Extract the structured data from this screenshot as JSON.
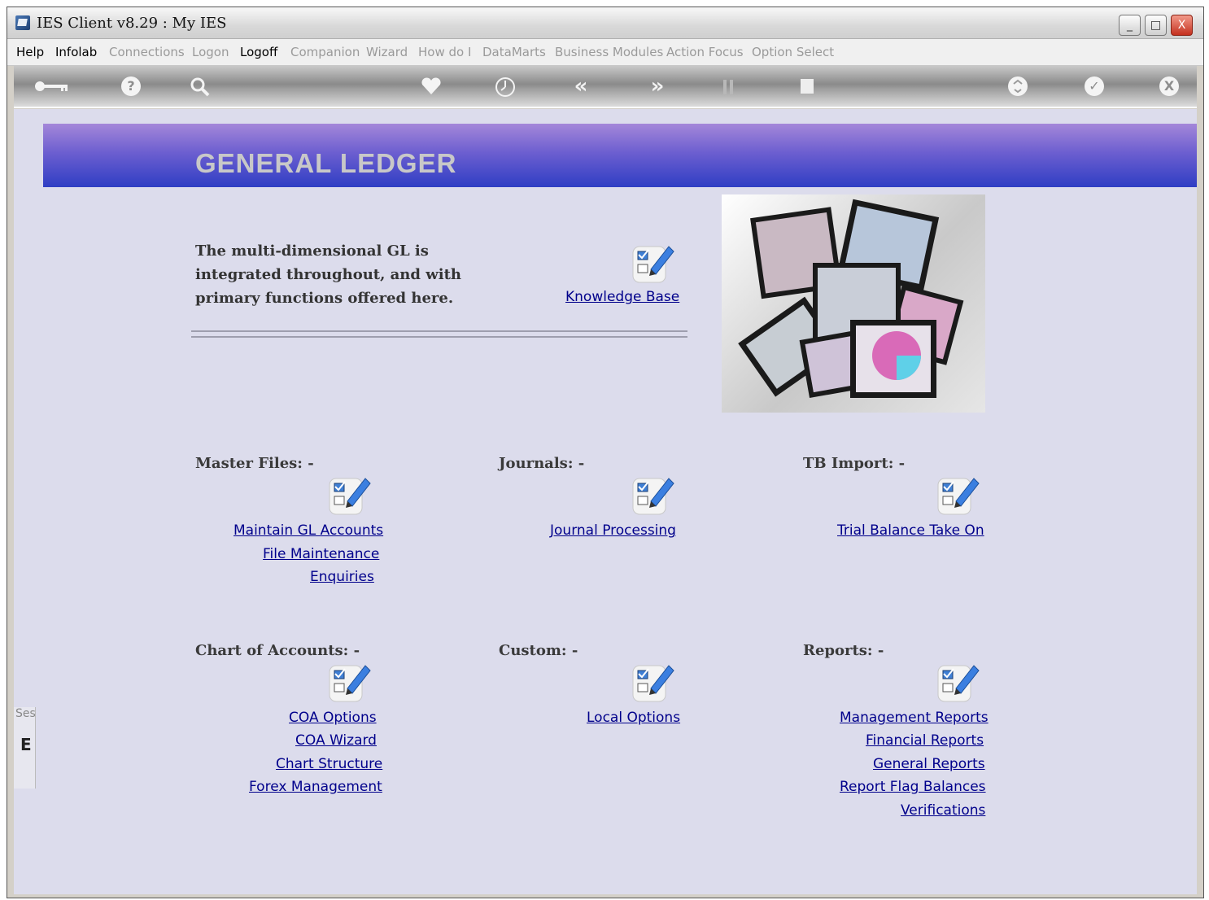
{
  "window": {
    "title": "IES Client v8.29 : My IES",
    "controls": {
      "minimize": "_",
      "maximize": "□",
      "close": "X"
    }
  },
  "menu": {
    "items": [
      {
        "label": "Help",
        "enabled": true
      },
      {
        "label": "Infolab",
        "enabled": true
      },
      {
        "label": "Connections",
        "enabled": false
      },
      {
        "label": "Logon",
        "enabled": false
      },
      {
        "label": "Logoff",
        "enabled": true
      },
      {
        "label": "Companion",
        "enabled": false
      },
      {
        "label": "Wizard",
        "enabled": false
      },
      {
        "label": "How do I",
        "enabled": false
      },
      {
        "label": "DataMarts",
        "enabled": false
      },
      {
        "label": "Business Modules",
        "enabled": false
      },
      {
        "label": "Action Focus",
        "enabled": false
      },
      {
        "label": "Option Select",
        "enabled": false
      }
    ]
  },
  "toolbar": {
    "icons": [
      "key-icon",
      "help-icon",
      "search-icon",
      "heart-icon",
      "clock-icon",
      "back-icon",
      "forward-icon",
      "columns-icon",
      "stop-icon",
      "recycle-icon",
      "check-icon",
      "close-icon"
    ],
    "glyphs": {
      "help": "?",
      "back": "«",
      "forward": "»",
      "check": "✓",
      "close": "X"
    }
  },
  "page": {
    "title": "GENERAL  LEDGER",
    "intro": "The multi-dimensional GL is integrated throughout, and with primary functions offered here.",
    "knowledge_base": "Knowledge Base"
  },
  "sections": {
    "master_files": {
      "title": "Master Files: -",
      "links": [
        "Maintain GL Accounts",
        "File Maintenance",
        "Enquiries"
      ]
    },
    "journals": {
      "title": "Journals: -",
      "links": [
        "Journal Processing"
      ]
    },
    "tb_import": {
      "title": "TB Import: -",
      "links": [
        "Trial Balance Take On"
      ]
    },
    "chart_of_accounts": {
      "title": "Chart of Accounts: -",
      "links": [
        "COA Options",
        "COA Wizard",
        "Chart Structure",
        "Forex Management"
      ]
    },
    "custom": {
      "title": "Custom: -",
      "links": [
        "Local Options"
      ]
    },
    "reports": {
      "title": "Reports: -",
      "links": [
        "Management Reports",
        "Financial Reports",
        "General Reports",
        "Report Flag Balances",
        "Verifications"
      ]
    }
  },
  "side_panel": {
    "label": "Ses",
    "glyph": "E"
  },
  "colors": {
    "link": "#00008b",
    "header_top": "#a487d9",
    "header_bottom": "#2f3ec4",
    "content_bg": "#dcdcec"
  }
}
